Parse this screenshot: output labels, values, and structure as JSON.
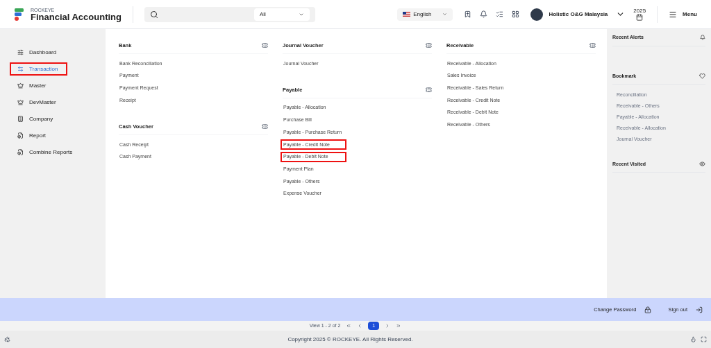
{
  "header": {
    "brand": "ROCKEYE",
    "app_name": "Financial Accounting",
    "search_scope": "All",
    "language": "English",
    "user": "Holistic O&G Malaysia",
    "year": "2025",
    "menu": "Menu"
  },
  "sidebar": {
    "items": [
      {
        "label": "Dashboard",
        "kind": "dashboard",
        "selected": false,
        "highlighted": false
      },
      {
        "label": "Transaction",
        "kind": "transaction",
        "selected": true,
        "highlighted": true
      },
      {
        "label": "Master",
        "kind": "master",
        "selected": false,
        "highlighted": false
      },
      {
        "label": "DevMaster",
        "kind": "master",
        "selected": false,
        "highlighted": false
      },
      {
        "label": "Company",
        "kind": "company",
        "selected": false,
        "highlighted": false
      },
      {
        "label": "Report",
        "kind": "report",
        "selected": false,
        "highlighted": false
      },
      {
        "label": "Combine Reports",
        "kind": "report",
        "selected": false,
        "highlighted": false
      }
    ]
  },
  "menu_columns": [
    [
      {
        "title": "Bank",
        "items": [
          {
            "label": "Bank Reconciliation",
            "highlighted": false
          },
          {
            "label": "Payment",
            "highlighted": false
          },
          {
            "label": "Payment Request",
            "highlighted": false
          },
          {
            "label": "Receipt",
            "highlighted": false
          }
        ]
      },
      {
        "title": "Cash Voucher",
        "items": [
          {
            "label": "Cash Receipt",
            "highlighted": false
          },
          {
            "label": "Cash Payment",
            "highlighted": false
          }
        ]
      }
    ],
    [
      {
        "title": "Journal Voucher",
        "items": [
          {
            "label": "Journal Voucher",
            "highlighted": false
          }
        ]
      },
      {
        "title": "Payable",
        "items": [
          {
            "label": "Payable - Allocation",
            "highlighted": false
          },
          {
            "label": "Purchase Bill",
            "highlighted": false
          },
          {
            "label": "Payable - Purchase Return",
            "highlighted": false
          },
          {
            "label": "Payable - Credit Note",
            "highlighted": true
          },
          {
            "label": "Payable - Debit Note",
            "highlighted": true
          },
          {
            "label": "Payment Plan",
            "highlighted": false
          },
          {
            "label": "Payable - Others",
            "highlighted": false
          },
          {
            "label": "Expense Voucher",
            "highlighted": false
          }
        ]
      }
    ],
    [
      {
        "title": "Receivable",
        "items": [
          {
            "label": "Receivable - Allocation",
            "highlighted": false
          },
          {
            "label": "Sales Invoice",
            "highlighted": false
          },
          {
            "label": "Receivable - Sales Return",
            "highlighted": false
          },
          {
            "label": "Receivable - Credit Note",
            "highlighted": false
          },
          {
            "label": "Receivable - Debit Note",
            "highlighted": false
          },
          {
            "label": "Receivable - Others",
            "highlighted": false
          }
        ]
      }
    ]
  ],
  "right_panel": {
    "recent_alerts": "Recent Alerts",
    "bookmark": "Bookmark",
    "bookmarks": [
      "Reconciliation",
      "Receivable - Others",
      "Payable - Allocation",
      "Receivable - Allocation",
      "Journal Voucher"
    ],
    "recent_visited": "Recent Visited"
  },
  "account_bar": {
    "change_password": "Change Password",
    "sign_out": "Sign out"
  },
  "pagination": {
    "summary": "View 1 - 2 of 2",
    "page": "1"
  },
  "footer": {
    "copyright": "Copyright 2025 © ROCKEYE. All Rights Reserved."
  }
}
